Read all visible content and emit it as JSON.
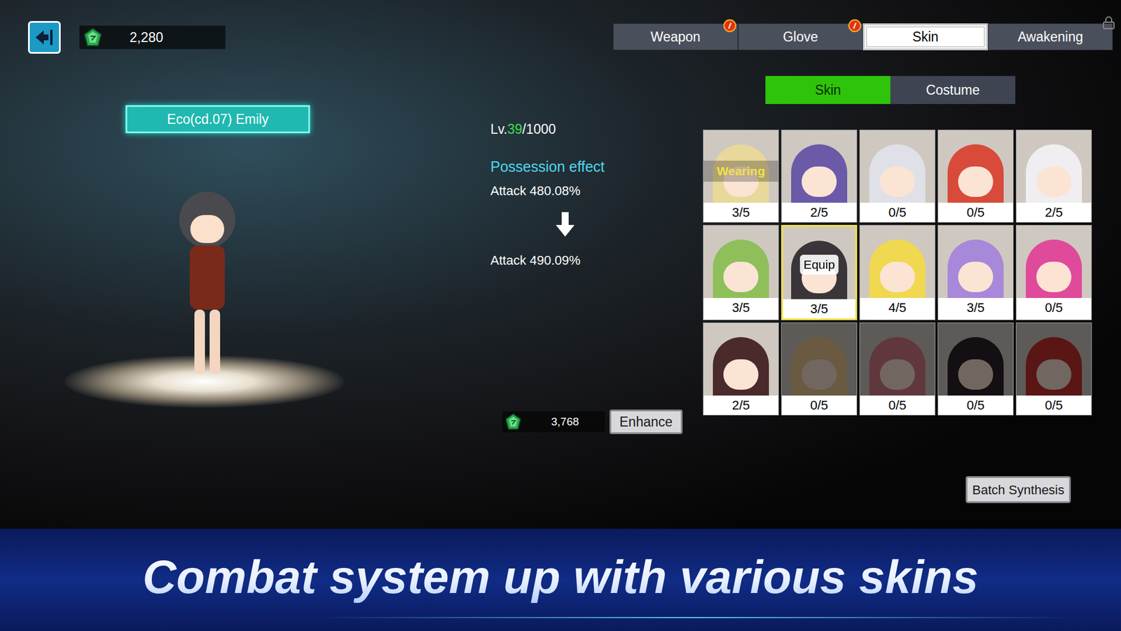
{
  "currency": {
    "amount": "2,280"
  },
  "character": {
    "name": "Eco(cd.07) Emily"
  },
  "level": {
    "prefix": "Lv.",
    "current": "39",
    "max": "/1000"
  },
  "effect": {
    "title": "Possession effect",
    "before": "Attack 480.08%",
    "after": "Attack 490.09%"
  },
  "enhance": {
    "cost": "3,768",
    "button": "Enhance"
  },
  "tabs": [
    {
      "label": "Weapon",
      "selected": false,
      "badge": true,
      "locked": false
    },
    {
      "label": "Glove",
      "selected": false,
      "badge": true,
      "locked": false
    },
    {
      "label": "Skin",
      "selected": true,
      "badge": false,
      "locked": false
    },
    {
      "label": "Awakening",
      "selected": false,
      "badge": false,
      "locked": true
    }
  ],
  "sub_tabs": [
    {
      "label": "Skin",
      "selected": true
    },
    {
      "label": "Costume",
      "selected": false
    }
  ],
  "skins": [
    {
      "count": "3/5",
      "selected": false,
      "wearing": true,
      "owned": true,
      "tag": "Wearing",
      "color": "#e8d89a"
    },
    {
      "count": "2/5",
      "selected": false,
      "wearing": false,
      "owned": true,
      "color": "#6a5aa8"
    },
    {
      "count": "0/5",
      "selected": false,
      "wearing": false,
      "owned": true,
      "color": "#e0e0e8"
    },
    {
      "count": "0/5",
      "selected": false,
      "wearing": false,
      "owned": true,
      "color": "#d84a3a"
    },
    {
      "count": "2/5",
      "selected": false,
      "wearing": false,
      "owned": true,
      "color": "#f0eef0"
    },
    {
      "count": "3/5",
      "selected": false,
      "wearing": false,
      "owned": true,
      "color": "#8fbf5a"
    },
    {
      "count": "3/5",
      "selected": true,
      "wearing": false,
      "owned": true,
      "tag": "Equip",
      "color": "#3a3538"
    },
    {
      "count": "4/5",
      "selected": false,
      "wearing": false,
      "owned": true,
      "color": "#f0d850"
    },
    {
      "count": "3/5",
      "selected": false,
      "wearing": false,
      "owned": true,
      "color": "#a888d8"
    },
    {
      "count": "0/5",
      "selected": false,
      "wearing": false,
      "owned": true,
      "color": "#e04a9a"
    },
    {
      "count": "2/5",
      "selected": false,
      "wearing": false,
      "owned": true,
      "color": "#4a2a2a"
    },
    {
      "count": "0/5",
      "selected": false,
      "wearing": false,
      "owned": false,
      "color": "#e8c890"
    },
    {
      "count": "0/5",
      "selected": false,
      "wearing": false,
      "owned": false,
      "color": "#d87a8a"
    },
    {
      "count": "0/5",
      "selected": false,
      "wearing": false,
      "owned": false,
      "color": "#2a2228"
    },
    {
      "count": "0/5",
      "selected": false,
      "wearing": false,
      "owned": false,
      "color": "#c83030"
    }
  ],
  "batch_button": "Batch Synthesis",
  "banner": {
    "text": "Combat system up with various skins"
  }
}
